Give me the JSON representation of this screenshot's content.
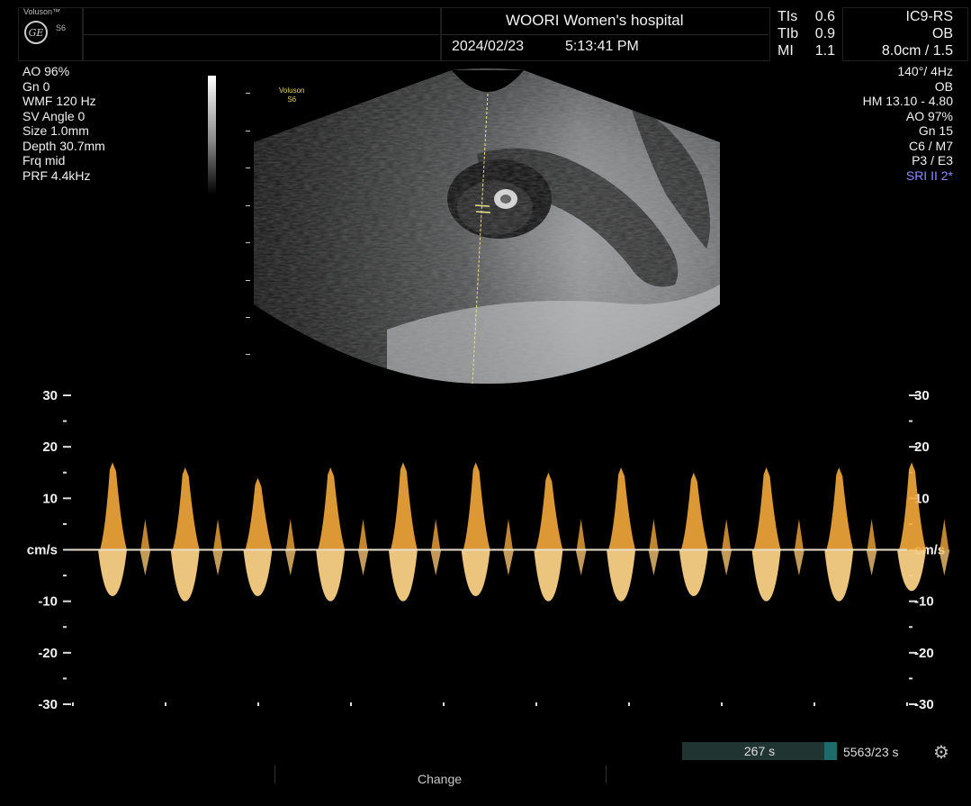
{
  "header": {
    "brand": "Voluson™",
    "model": "S6",
    "hospital": "WOORI Women's hospital",
    "date": "2024/02/23",
    "time": "5:13:41 PM",
    "indices": [
      {
        "label": "TIs",
        "value": "0.6"
      },
      {
        "label": "TIb",
        "value": "0.9"
      },
      {
        "label": "MI",
        "value": "1.1"
      }
    ],
    "probe": "IC9-RS",
    "exam": "OB",
    "depth_sector": "8.0cm / 1.5"
  },
  "doppler_params": [
    "AO 96%",
    "Gn  0",
    "WMF 120 Hz",
    "SV Angle  0",
    "Size  1.0mm",
    "Depth 30.7mm",
    "Frq mid",
    "PRF  4.4kHz"
  ],
  "bmode_params": [
    "140°/  4Hz",
    "OB",
    "HM  13.10 - 4.80",
    "AO 97%",
    "Gn  15",
    "C6 / M7",
    "P3 / E3"
  ],
  "sri": "SRI II 2*",
  "image_label": {
    "line1": "Voluson",
    "line2": "S6"
  },
  "axis": {
    "labels": [
      "30",
      "20",
      "10",
      "cm/s",
      "-10",
      "-20",
      "-30"
    ],
    "unit": "cm/s"
  },
  "status": {
    "progress": "267 s",
    "cine": "5563/23 s"
  },
  "bottom": {
    "change": "Change"
  },
  "chart_data": {
    "type": "line",
    "title": "",
    "xlabel": "",
    "ylabel": "cm/s",
    "ylim": [
      -30,
      30
    ],
    "yticks": [
      30,
      20,
      10,
      0,
      -10,
      -20,
      -30
    ],
    "series": [
      {
        "values": [
          17,
          16,
          14,
          16,
          17,
          17,
          15,
          16,
          15,
          16,
          16,
          17
        ]
      },
      {
        "values": [
          -9,
          -10,
          -9,
          -10,
          -10,
          -9,
          -10,
          -10,
          -9,
          -10,
          -10,
          -8
        ]
      }
    ]
  },
  "colors": {
    "doppler": "#f3a83a",
    "baseline": "#e8e0c8",
    "sri": "#8c8cff"
  }
}
